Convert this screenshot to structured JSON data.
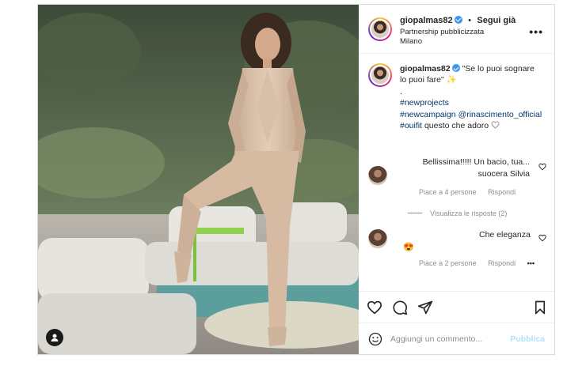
{
  "post": {
    "username": "giopalmas82",
    "follow_label": "Segui già",
    "dot": "•",
    "partnership": "Partnership pubblicizzata",
    "location": "Milano",
    "more_icon": "more-horizontal-icon"
  },
  "caption": {
    "username": "giopalmas82",
    "text": "\"Se lo puoi sognare lo puoi fare\" ✨",
    "dot": ".",
    "tag1": "#newprojects",
    "tag2": "#newcampaign",
    "mention": "@rinascimento_official",
    "tag3": "#ouifit",
    "tail": "questo che adoro"
  },
  "comments": [
    {
      "text": "Bellissima!!!!! Un bacio, tua... suocera Silvia",
      "likes": "Piace a 4 persone",
      "reply": "Rispondi",
      "view_replies": "Visualizza le risposte (2)"
    },
    {
      "text": "Che eleganza",
      "emoji": "😍",
      "likes": "Piace a 2 persone",
      "reply": "Rispondi",
      "more": "•••"
    }
  ],
  "actions": [
    "heart-icon",
    "comment-icon",
    "share-icon",
    "bookmark-icon"
  ],
  "composer": {
    "placeholder": "Aggiungi un commento...",
    "publish": "Pubblica"
  },
  "colors": {
    "link": "#00376b",
    "verified": "#3897f0",
    "publish_disabled": "#b2dffc",
    "muted": "#8e8e8e"
  }
}
